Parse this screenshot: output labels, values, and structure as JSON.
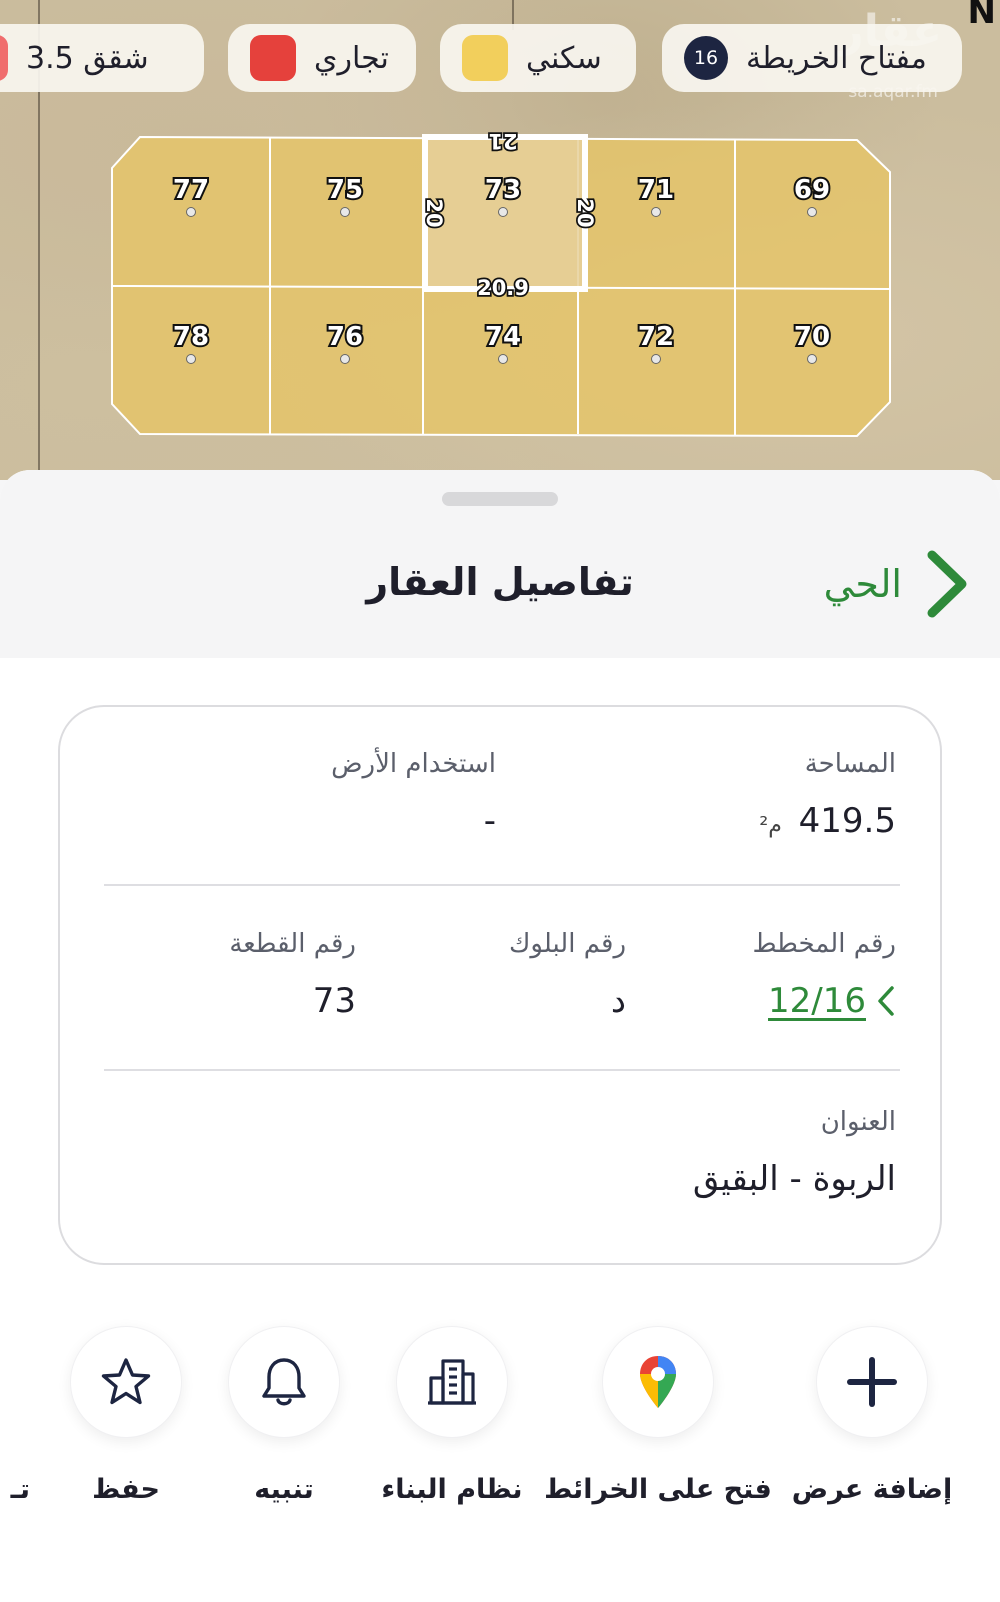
{
  "map": {
    "watermark": "عقار",
    "watermark_url": "sa.aqar.fm",
    "north_marker": "N",
    "legend": [
      {
        "label": "مفتاح الخريطة",
        "count": "16"
      },
      {
        "label": "سكني",
        "color": "#f2cf5c"
      },
      {
        "label": "تجاري",
        "color": "#e5413c"
      },
      {
        "label": "شقق 3.5",
        "color": "#f06d6d"
      }
    ],
    "plots_top": [
      "77",
      "75",
      "73",
      "71",
      "69"
    ],
    "plots_bottom": [
      "78",
      "76",
      "74",
      "72",
      "70"
    ],
    "selected_plot": {
      "number": "73",
      "dim_top": "21",
      "dim_bottom": "20.9",
      "dim_left": "20",
      "dim_right": "20"
    }
  },
  "sheet": {
    "title": "تفاصيل العقار",
    "back_label": "الحي"
  },
  "details": {
    "area_label": "المساحة",
    "area_value": "419.5",
    "area_unit": "م²",
    "land_use_label": "استخدام الأرض",
    "land_use_value": "-",
    "plan_label": "رقم المخطط",
    "plan_value": "12/16",
    "block_label": "رقم البلوك",
    "block_value": "د",
    "parcel_label": "رقم القطعة",
    "parcel_value": "73",
    "address_label": "العنوان",
    "address_value": "الربوة - البقيق"
  },
  "actions": [
    {
      "label": "إضافة عرض",
      "icon": "plus-icon"
    },
    {
      "label": "فتح على الخرائط",
      "icon": "map-pin-icon"
    },
    {
      "label": "نظام البناء",
      "icon": "building-icon"
    },
    {
      "label": "تنبيه",
      "icon": "bell-icon"
    },
    {
      "label": "حفظ",
      "icon": "star-icon"
    },
    {
      "label": "تـ",
      "icon": ""
    }
  ],
  "colors": {
    "accent_green": "#2e8a3a",
    "plot_fill": "#e6c76d",
    "badge_navy": "#1d2541"
  }
}
